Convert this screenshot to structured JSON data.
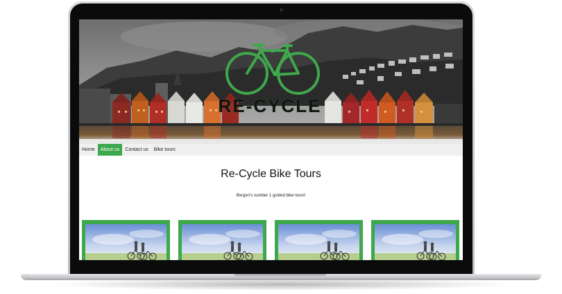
{
  "site": {
    "logo_text": "RE-CYCLE",
    "title": "Re-Cycle Bike Tours",
    "subtitle": "Bergen's number 1 guided bike tours!"
  },
  "nav": {
    "items": [
      {
        "label": "Home",
        "active": false
      },
      {
        "label": "About us",
        "active": true
      },
      {
        "label": "Contact us",
        "active": false
      },
      {
        "label": "Bike tours",
        "active": false
      }
    ]
  },
  "cards": [
    {
      "image": "cyclists-photo"
    },
    {
      "image": "cyclists-photo"
    },
    {
      "image": "cyclists-photo"
    },
    {
      "image": "cyclists-photo"
    }
  ],
  "colors": {
    "accent": "#3ea84c",
    "nav_bg": "#f0f0f0"
  }
}
